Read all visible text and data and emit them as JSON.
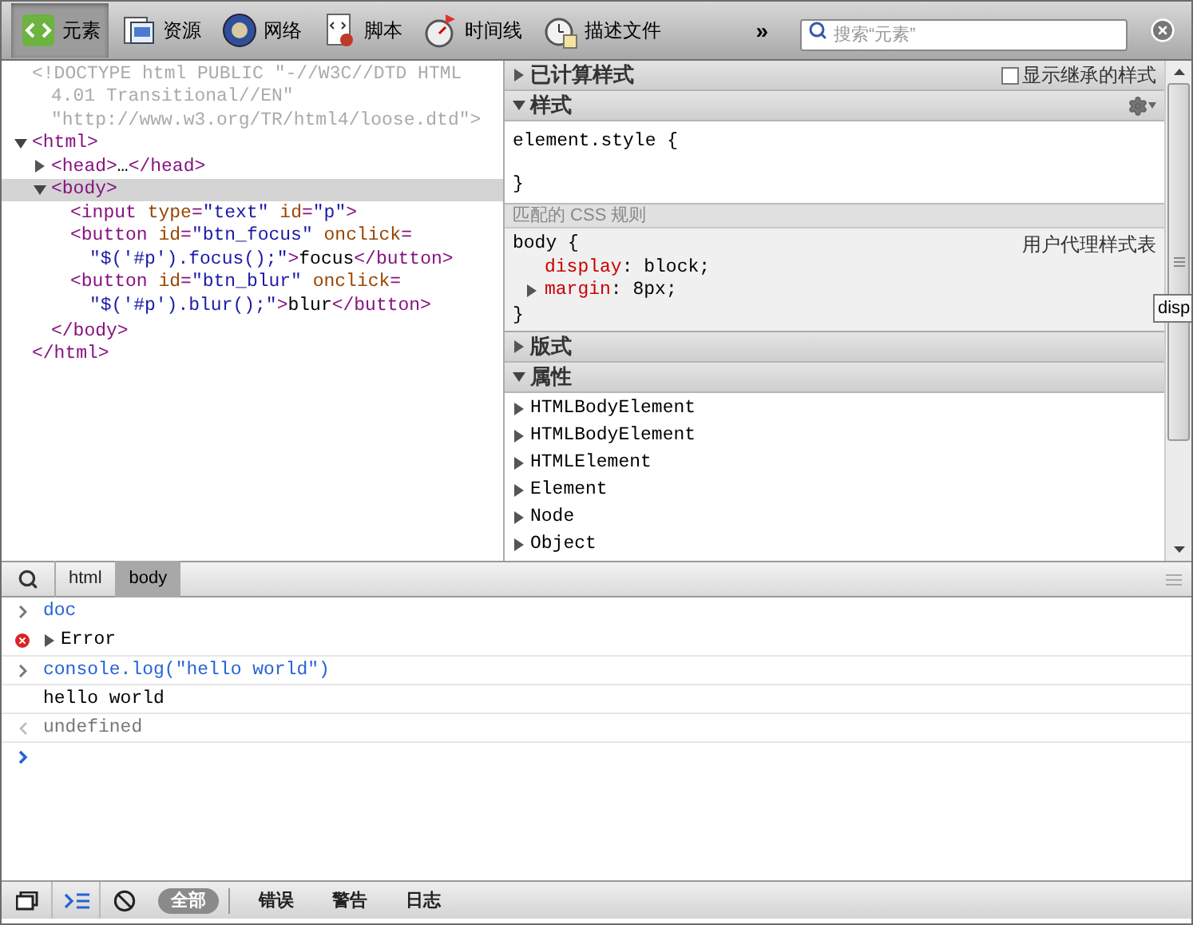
{
  "toolbar": {
    "tools": [
      {
        "kind": "elements",
        "label": "元素",
        "selected": true
      },
      {
        "kind": "resources",
        "label": "资源",
        "selected": false
      },
      {
        "kind": "network",
        "label": "网络",
        "selected": false
      },
      {
        "kind": "scripts",
        "label": "脚本",
        "selected": false
      },
      {
        "kind": "timeline",
        "label": "时间线",
        "selected": false
      },
      {
        "kind": "profiles",
        "label": "描述文件",
        "selected": false
      }
    ],
    "more": "»",
    "search": {
      "placeholder": "搜索“元素”"
    }
  },
  "dom_tree": [
    {
      "selected": false,
      "lines": [
        [
          {
            "kind": "doctype",
            "text": "<!DOCTYPE html PUBLIC \"-//W3C//DTD HTML"
          }
        ],
        [
          {
            "kind": "doctype",
            "text": "4.01 Transitional//EN\""
          }
        ],
        [
          {
            "kind": "doctype",
            "text": "\"http://www.w3.org/TR/html4/loose.dtd\">"
          }
        ]
      ]
    },
    {
      "selected": false,
      "expanded": true,
      "lines": [
        [
          {
            "kind": "tag",
            "text": "<html>"
          }
        ]
      ],
      "close": [
        {
          "kind": "tag",
          "text": "</html>"
        }
      ],
      "children": [
        {
          "selected": false,
          "expanded": false,
          "lines": [
            [
              {
                "kind": "tag",
                "text": "<head>"
              },
              {
                "kind": "text",
                "text": "…"
              },
              {
                "kind": "tag",
                "text": "</head>"
              }
            ]
          ]
        },
        {
          "selected": true,
          "expanded": true,
          "lines": [
            [
              {
                "kind": "tag",
                "text": "<body>"
              }
            ]
          ],
          "close": [
            {
              "kind": "tag",
              "text": "</body>"
            }
          ],
          "children": [
            {
              "selected": false,
              "lines": [
                [
                  {
                    "kind": "tag",
                    "text": "<input"
                  },
                  {
                    "kind": "attr",
                    "text": " type"
                  },
                  {
                    "kind": "tag",
                    "text": "="
                  },
                  {
                    "kind": "value",
                    "text": "\"text\""
                  },
                  {
                    "kind": "attr",
                    "text": " id"
                  },
                  {
                    "kind": "tag",
                    "text": "="
                  },
                  {
                    "kind": "value",
                    "text": "\"p\""
                  },
                  {
                    "kind": "tag",
                    "text": ">"
                  }
                ]
              ]
            },
            {
              "selected": false,
              "lines": [
                [
                  {
                    "kind": "tag",
                    "text": "<button"
                  },
                  {
                    "kind": "attr",
                    "text": " id"
                  },
                  {
                    "kind": "tag",
                    "text": "="
                  },
                  {
                    "kind": "value",
                    "text": "\"btn_focus\""
                  },
                  {
                    "kind": "attr",
                    "text": " onclick"
                  },
                  {
                    "kind": "tag",
                    "text": "="
                  }
                ],
                [
                  {
                    "kind": "value",
                    "text": "\"$('#p').focus();\""
                  },
                  {
                    "kind": "tag",
                    "text": ">"
                  },
                  {
                    "kind": "text",
                    "text": "focus"
                  },
                  {
                    "kind": "tag",
                    "text": "</button>"
                  }
                ]
              ]
            },
            {
              "selected": false,
              "lines": [
                [
                  {
                    "kind": "tag",
                    "text": "<button"
                  },
                  {
                    "kind": "attr",
                    "text": " id"
                  },
                  {
                    "kind": "tag",
                    "text": "="
                  },
                  {
                    "kind": "value",
                    "text": "\"btn_blur\""
                  },
                  {
                    "kind": "attr",
                    "text": " onclick"
                  },
                  {
                    "kind": "tag",
                    "text": "="
                  }
                ],
                [
                  {
                    "kind": "value",
                    "text": "\"$('#p').blur();\""
                  },
                  {
                    "kind": "tag",
                    "text": ">"
                  },
                  {
                    "kind": "text",
                    "text": "blur"
                  },
                  {
                    "kind": "tag",
                    "text": "</button>"
                  }
                ]
              ]
            }
          ]
        }
      ]
    }
  ],
  "sidebar": {
    "computed": {
      "title": "已计算样式",
      "expanded": false,
      "show_inherited": {
        "label": "显示继承的样式",
        "checked": false
      }
    },
    "styles": {
      "title": "样式",
      "expanded": true,
      "element_style": {
        "open": "element.style {",
        "close": "}"
      },
      "matched_header": "匹配的 CSS 规则",
      "rule": {
        "selector": "body {",
        "source": "用户代理样式表",
        "close": "}",
        "properties": [
          {
            "name": "display",
            "separator": ":",
            "value": "block;",
            "expandable": false
          },
          {
            "name": "margin",
            "separator": ":",
            "value": "8px;",
            "expandable": true
          }
        ]
      }
    },
    "metrics": {
      "title": "版式",
      "expanded": false
    },
    "properties": {
      "title": "属性",
      "expanded": true,
      "items": [
        "HTMLBodyElement",
        "HTMLBodyElement",
        "HTMLElement",
        "Element",
        "Node",
        "Object"
      ]
    }
  },
  "tooltip": "disp",
  "breadcrumbs": [
    {
      "label": "html",
      "selected": false
    },
    {
      "label": "body",
      "selected": true
    }
  ],
  "console": [
    {
      "kind": "input",
      "text": "doc"
    },
    {
      "kind": "error",
      "text": "Error"
    },
    {
      "kind": "input",
      "text": "console.log(\"hello world\")"
    },
    {
      "kind": "output",
      "text": "hello world"
    },
    {
      "kind": "result",
      "text": "undefined"
    },
    {
      "kind": "prompt"
    }
  ],
  "status_bar": {
    "filters": [
      {
        "label": "全部",
        "selected": true
      },
      {
        "label": "错误",
        "selected": false
      },
      {
        "label": "警告",
        "selected": false
      },
      {
        "label": "日志",
        "selected": false
      }
    ]
  }
}
